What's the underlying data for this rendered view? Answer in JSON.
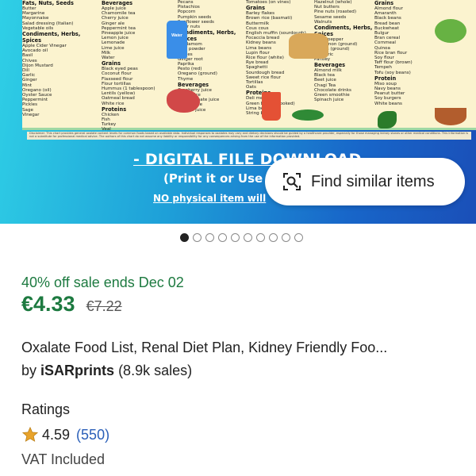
{
  "hero": {
    "columns": [
      {
        "sections": [
          {
            "heading": "Fats, Nuts, Seeds",
            "items": [
              "Butter",
              "Margarine",
              "Mayonnaise",
              "Salad dressing (Italian)",
              "Vegetable oils"
            ]
          },
          {
            "heading": "Condiments, Herbs, Spices",
            "items": [
              "Apple Cider Vinegar",
              "Avocado oil",
              "Basil",
              "Chives",
              "Dijon Mustard",
              "Dill",
              "Garlic",
              "Ginger",
              "Mint",
              "Oregano (oil)",
              "Oyster Sauce",
              "Peppermint",
              "Pickles",
              "Sage",
              "Vinegar"
            ]
          }
        ]
      },
      {
        "sections": [
          {
            "heading": "Beverages",
            "items": [
              "Apple juice",
              "Chamomile tea",
              "Cherry juice",
              "Ginger ale",
              "Peppermint tea",
              "Pineapple juice",
              "Lemon juice",
              "Lemonade",
              "Lime juice",
              "Milk",
              "Water"
            ]
          },
          {
            "heading": "Grains",
            "items": [
              "Black eyed peas",
              "Coconut flour",
              "Flaxseed flour",
              "Flour tortillas",
              "Hummus (1 tablespoon)",
              "Lentils (yellow)",
              "Oatmeal bread",
              "White rice"
            ]
          },
          {
            "heading": "Proteins",
            "items": [
              "Chicken",
              "Fish",
              "Turkey",
              "Veal"
            ]
          }
        ]
      },
      {
        "sections": [
          {
            "heading": "",
            "items": [
              "Pecans",
              "Pistachios",
              "Popcorn",
              "Pumpkin seeds",
              "Sunflower seeds",
              "Tiger nuts"
            ]
          },
          {
            "heading": "Condiments, Herbs, Spices",
            "items": [
              "Cardamom",
              "Chili powder",
              "Chives",
              "Ginger root",
              "Paprika",
              "Pesto (red)",
              "Oregano (ground)",
              "Thyme"
            ]
          },
          {
            "heading": "Beverages",
            "items": [
              "Cranberry juice",
              "Plum juice",
              "Pomegranate juice",
              "Prune juice",
              "Tomato juice"
            ]
          }
        ]
      },
      {
        "sections": [
          {
            "heading": "",
            "items": [
              "Tomatoes (on vines)"
            ]
          },
          {
            "heading": "Grains",
            "items": [
              "Barley flakes",
              "Brown rice (basmati)",
              "Buttermilk",
              "Cous cous",
              "English muffin (sourdough)",
              "Focaccia bread",
              "Kidney beans",
              "Lima beans",
              "Lupin flour",
              "Rice flour (white)",
              "Rye bread",
              "Spaghetti",
              "Sourdough bread",
              "Sweet rice flour",
              "Tortillas",
              "Oats"
            ]
          },
          {
            "heading": "Proteins",
            "items": [
              "Deli meats",
              "Green beans (cooked)",
              "Lima beans",
              "String beans"
            ]
          }
        ]
      },
      {
        "sections": [
          {
            "heading": "",
            "items": [
              "Hazelnut (whole)",
              "Nut butters",
              "Pine nuts (roasted)",
              "Sesame seeds",
              "Walnuts"
            ]
          },
          {
            "heading": "Condiments, Herbs, Spices",
            "items": [
              "Black pepper",
              "Cinnamon (ground)",
              "Cloves (ground)",
              "Turmeric",
              "Parsley"
            ]
          },
          {
            "heading": "Beverages",
            "items": [
              "Almond milk",
              "Black tea",
              "Beet juice",
              "Chagi Tea",
              "Chocolate drinks",
              "Green smoothie",
              "Spinach juice"
            ]
          }
        ]
      },
      {
        "sections": [
          {
            "heading": "Grains",
            "items": [
              "Almond flour",
              "Amaranth",
              "Black beans",
              "Bread bean",
              "Buckwheat",
              "Bulgur",
              "Bran cereal",
              "Cornmeal",
              "Quinoa",
              "Rice bran flour",
              "Soy flour",
              "Teff flour (brown)",
              "Tempeh",
              "Tofu (soy beans)"
            ]
          },
          {
            "heading": "Protein",
            "items": [
              "Miso soup",
              "Navy beans",
              "Peanut butter",
              "Soy burgers",
              "White beans"
            ]
          }
        ]
      }
    ],
    "water_label": "Water",
    "disclaimer": "Disclaimer: This chart provides general oxalate content levels for common foods based on available data. Individual responses to oxalates may vary and dietary decisions should be guided by a healthcare provider, especially for those managing kidney stones or other medical conditions. This information is not a substitute for professional medical advice. The authors of this chart do not assume any liability or responsibility for any consequences arising from the use of the information provided.",
    "promo_line1": "- DIGITAL FILE DOWNLOAD",
    "promo_line2": "(Print it or Use",
    "promo_line3": "NO physical item will",
    "find_similar_label": "Find similar items",
    "find_similar_icon": "image-search-icon"
  },
  "carousel": {
    "total": 10,
    "active_index": 0
  },
  "listing": {
    "sale_text": "40% off sale ends Dec 02",
    "price": "€4.33",
    "original_price": "€7.22",
    "title": "Oxalate Food List, Renal Diet Plan, Kidney Friendly Foo...",
    "by_prefix": "by",
    "shop_name": "iSARprints",
    "sales": "(8.9k sales)",
    "ratings_heading": "Ratings",
    "rating_value": "4.59",
    "rating_count": "(550)",
    "vat": "VAT Included"
  },
  "colors": {
    "sale_green": "#1d7a40",
    "link_blue": "#2a5fb8",
    "star": "#e8a32b"
  }
}
